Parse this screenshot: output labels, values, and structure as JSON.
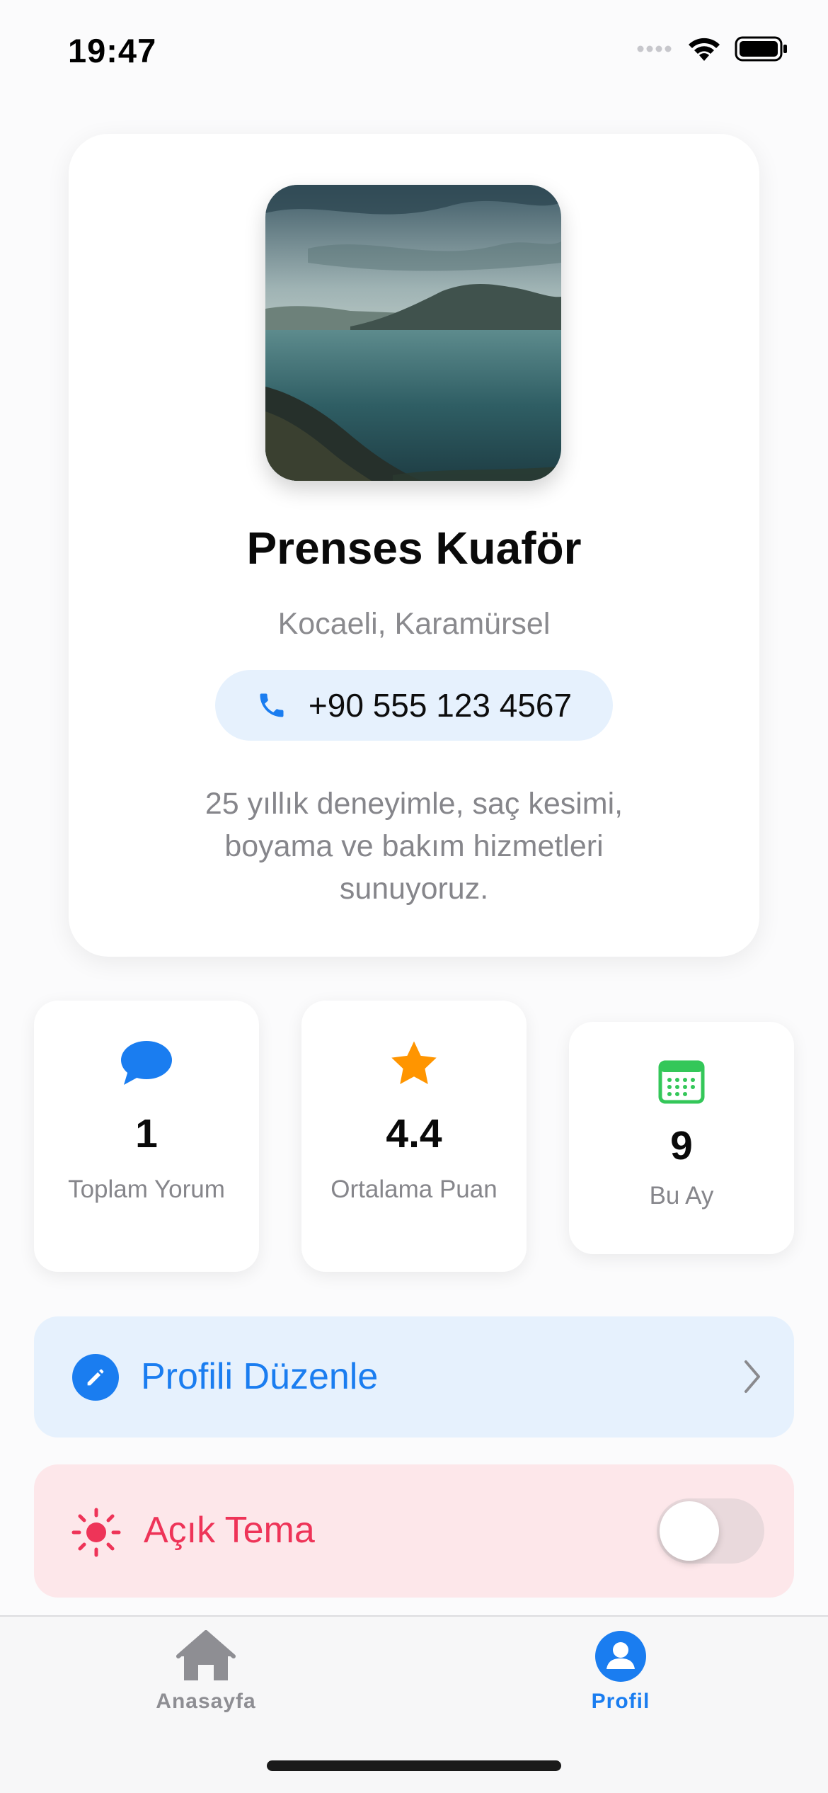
{
  "status_bar": {
    "time": "19:47"
  },
  "profile": {
    "name": "Prenses Kuaför",
    "location": "Kocaeli, Karamürsel",
    "phone": "+90 555 123 4567",
    "description": "25 yıllık deneyimle, saç kesimi, boyama ve bakım hizmetleri sunuyoruz.",
    "photo_icon": "landscape-lake-photo"
  },
  "stats": [
    {
      "icon": "speech-bubble-icon",
      "value": "1",
      "label": "Toplam Yorum",
      "color": "#1a7df0"
    },
    {
      "icon": "star-icon",
      "value": "4.4",
      "label": "Ortalama Puan",
      "color": "#ff9500"
    },
    {
      "icon": "calendar-icon",
      "value": "9",
      "label": "Bu Ay",
      "color": "#34c759"
    }
  ],
  "actions": {
    "edit_profile": {
      "label": "Profili Düzenle",
      "icon": "pencil-icon",
      "color": "#1a7df0"
    },
    "theme": {
      "label": "Açık Tema",
      "icon": "sun-icon",
      "color": "#ee3458",
      "toggle_on": false
    }
  },
  "tab_bar": {
    "tabs": [
      {
        "label": "Anasayfa",
        "icon": "house-icon",
        "active": false,
        "color": "#8e8e93"
      },
      {
        "label": "Profil",
        "icon": "person-circle-icon",
        "active": true,
        "color": "#1a7df0"
      }
    ]
  }
}
